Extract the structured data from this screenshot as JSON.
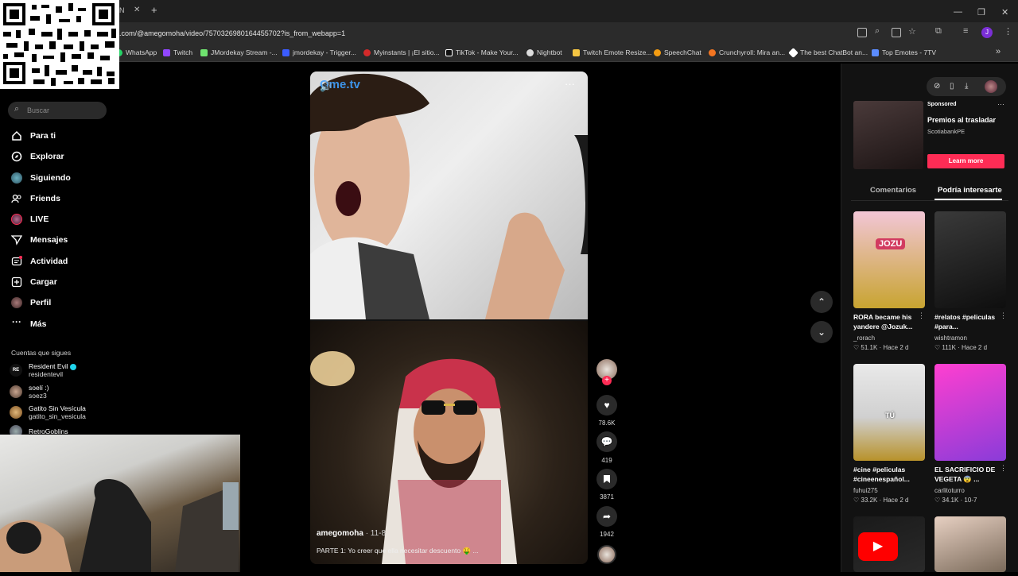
{
  "browser": {
    "url": ".com/@amegomoha/video/7570326980164455702?is_from_webapp=1",
    "tab_label": "N",
    "new_tab": "+",
    "window_controls": [
      "—",
      "❐",
      "✕"
    ],
    "bookmarks": [
      {
        "label": "WhatsApp",
        "color": "#25d366"
      },
      {
        "label": "Twitch",
        "color": "#9146ff"
      },
      {
        "label": "JMordekay Stream -...",
        "color": "#6fe36f"
      },
      {
        "label": "jmordekay - Trigger...",
        "color": "#3b5cff"
      },
      {
        "label": "Myinstants | ¡El sitio...",
        "color": "#d42a2a"
      },
      {
        "label": "TikTok - Make Your...",
        "color": "#ffffff"
      },
      {
        "label": "Nightbot",
        "color": "#dddddd"
      },
      {
        "label": "Twitch Emote Resize...",
        "color": "#f4c542"
      },
      {
        "label": "SpeechChat",
        "color": "#f39c12"
      },
      {
        "label": "Crunchyroll: Mira an...",
        "color": "#f47521"
      },
      {
        "label": "The best ChatBot an...",
        "color": "#ffffff"
      },
      {
        "label": "Top Emotes - 7TV",
        "color": "#5b8cff"
      }
    ],
    "bookmarks_more": "»"
  },
  "sidebar": {
    "search_placeholder": "Buscar",
    "nav": [
      {
        "label": "Para ti",
        "icon": "home-icon"
      },
      {
        "label": "Explorar",
        "icon": "compass-icon"
      },
      {
        "label": "Siguiendo",
        "icon": "following-icon"
      },
      {
        "label": "Friends",
        "icon": "friends-icon"
      },
      {
        "label": "LIVE",
        "icon": "live-icon"
      },
      {
        "label": "Mensajes",
        "icon": "send-icon"
      },
      {
        "label": "Actividad",
        "icon": "inbox-icon"
      },
      {
        "label": "Cargar",
        "icon": "upload-icon"
      },
      {
        "label": "Perfil",
        "icon": "avatar-icon"
      },
      {
        "label": "Más",
        "icon": "more-icon"
      }
    ],
    "following_heading": "Cuentas que sigues",
    "following": [
      {
        "name": "Resident Evil",
        "handle": "residentevil",
        "verified": true,
        "initials": "RE"
      },
      {
        "name": "soelí :)",
        "handle": "soez3"
      },
      {
        "name": "Gatito Sin Vesícula",
        "handle": "gatito_sin_vesicula"
      },
      {
        "name": "RetroGoblins",
        "handle": ""
      }
    ]
  },
  "video": {
    "watermark": "Ome.tv",
    "author": "amegomoha",
    "author_suffix": "· 11-8",
    "caption": "PARTE 1: Yo creer que ella necesitar descuento 🤑 ...",
    "more": "···",
    "actions": [
      {
        "icon": "heart-icon",
        "count": "78.6K"
      },
      {
        "icon": "comment-icon",
        "count": "419"
      },
      {
        "icon": "bookmark-icon",
        "count": "3871"
      },
      {
        "icon": "share-icon",
        "count": "1942"
      }
    ]
  },
  "right_panel": {
    "sponsored": "Sponsored",
    "ad_title": "Premios al trasladar",
    "ad_brand": "ScotiabankPE",
    "ad_cta": "Learn more",
    "ad_cta_color": "#fe2c55",
    "tabs": [
      "Comentarios",
      "Podría interesarte"
    ],
    "active_tab": 1,
    "cards": [
      {
        "title": "RORA became his yandere @Jozuk...",
        "user": "_rorach",
        "likes": "51.1K",
        "date": "Hace 2 d",
        "thumb_label": "JOZU",
        "c1": "#f2c6d6",
        "c2": "#c8a430"
      },
      {
        "title": "#relatos #peliculas #para...",
        "user": "wishtramon",
        "likes": "111K",
        "date": "Hace 2 d",
        "thumb_label": "",
        "c1": "#3a3a3a",
        "c2": "#0e0e0e"
      },
      {
        "title": "#cine #peliculas #cineenespañol...",
        "user": "fuhui275",
        "likes": "33.2K",
        "date": "Hace 2 d",
        "thumb_label": "TÚ",
        "c1": "#e9e9e9",
        "c2": "#b8922a"
      },
      {
        "title": "EL SACRIFICIO DE VEGETA 😨 ...",
        "user": "carlitoturro",
        "likes": "34.1K",
        "date": "10-7",
        "thumb_label": "",
        "c1": "#ff3fd0",
        "c2": "#8a3cd9"
      },
      {
        "title": "",
        "user": "",
        "likes": "",
        "date": "",
        "thumb_label": "▶",
        "c1": "#1a1a1a",
        "c2": "#2a2a2a"
      },
      {
        "title": "",
        "user": "",
        "likes": "",
        "date": "",
        "thumb_label": "",
        "c1": "#e7d0c2",
        "c2": "#7a6a5a"
      }
    ]
  }
}
